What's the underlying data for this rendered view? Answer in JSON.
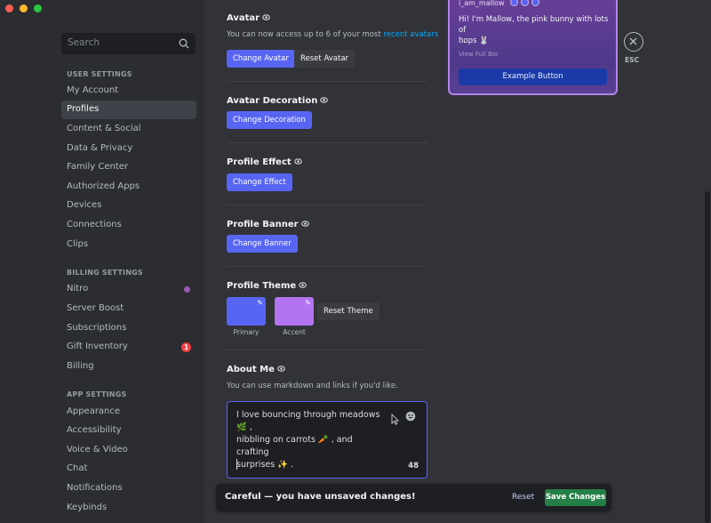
{
  "window": {
    "controls": [
      "#ff5f57",
      "#febc2e",
      "#28c840"
    ]
  },
  "sidebar": {
    "search_placeholder": "Search",
    "sections": [
      {
        "header": "USER SETTINGS",
        "items": [
          "My Account",
          "Profiles",
          "Content & Social",
          "Data & Privacy",
          "Family Center",
          "Authorized Apps",
          "Devices",
          "Connections",
          "Clips"
        ]
      },
      {
        "header": "BILLING SETTINGS",
        "items": [
          "Nitro",
          "Server Boost",
          "Subscriptions",
          "Gift Inventory",
          "Billing"
        ]
      },
      {
        "header": "APP SETTINGS",
        "items": [
          "Appearance",
          "Accessibility",
          "Voice & Video",
          "Chat",
          "Notifications",
          "Keybinds"
        ]
      }
    ],
    "active_item": "Profiles",
    "gift_badge": "1"
  },
  "avatar": {
    "title": "Avatar",
    "hint_prefix": "You can now access up to 6 of your most",
    "hint_link": "recent avatars",
    "change_label": "Change Avatar",
    "reset_label": "Reset Avatar"
  },
  "decoration": {
    "title": "Avatar Decoration",
    "change_label": "Change Decoration"
  },
  "effect": {
    "title": "Profile Effect",
    "change_label": "Change Effect"
  },
  "banner": {
    "title": "Profile Banner",
    "change_label": "Change Banner"
  },
  "theme": {
    "title": "Profile Theme",
    "primary_label": "Primary",
    "accent_label": "Accent",
    "primary_color": "#5865f2",
    "accent_color": "#b473f0",
    "reset_label": "Reset Theme"
  },
  "about": {
    "title": "About Me",
    "hint": "You can use markdown and links if you'd like.",
    "line1": "I love bouncing through meadows 🌿 ,",
    "line2": "nibbling on carrots 🥕 , and crafting",
    "line3": "surprises ✨ .",
    "counter": "48"
  },
  "preview": {
    "username": "i_am_mallow",
    "bio_line1": "Hi! I'm Mallow, the pink bunny with lots of",
    "bio_line2": "hops 🐰",
    "ellipsis": "...",
    "view_bio": "View Full Bio",
    "example_button": "Example Button"
  },
  "esc_label": "ESC",
  "notice": {
    "text": "Careful — you have unsaved changes!",
    "reset_label": "Reset",
    "save_label": "Save Changes"
  }
}
